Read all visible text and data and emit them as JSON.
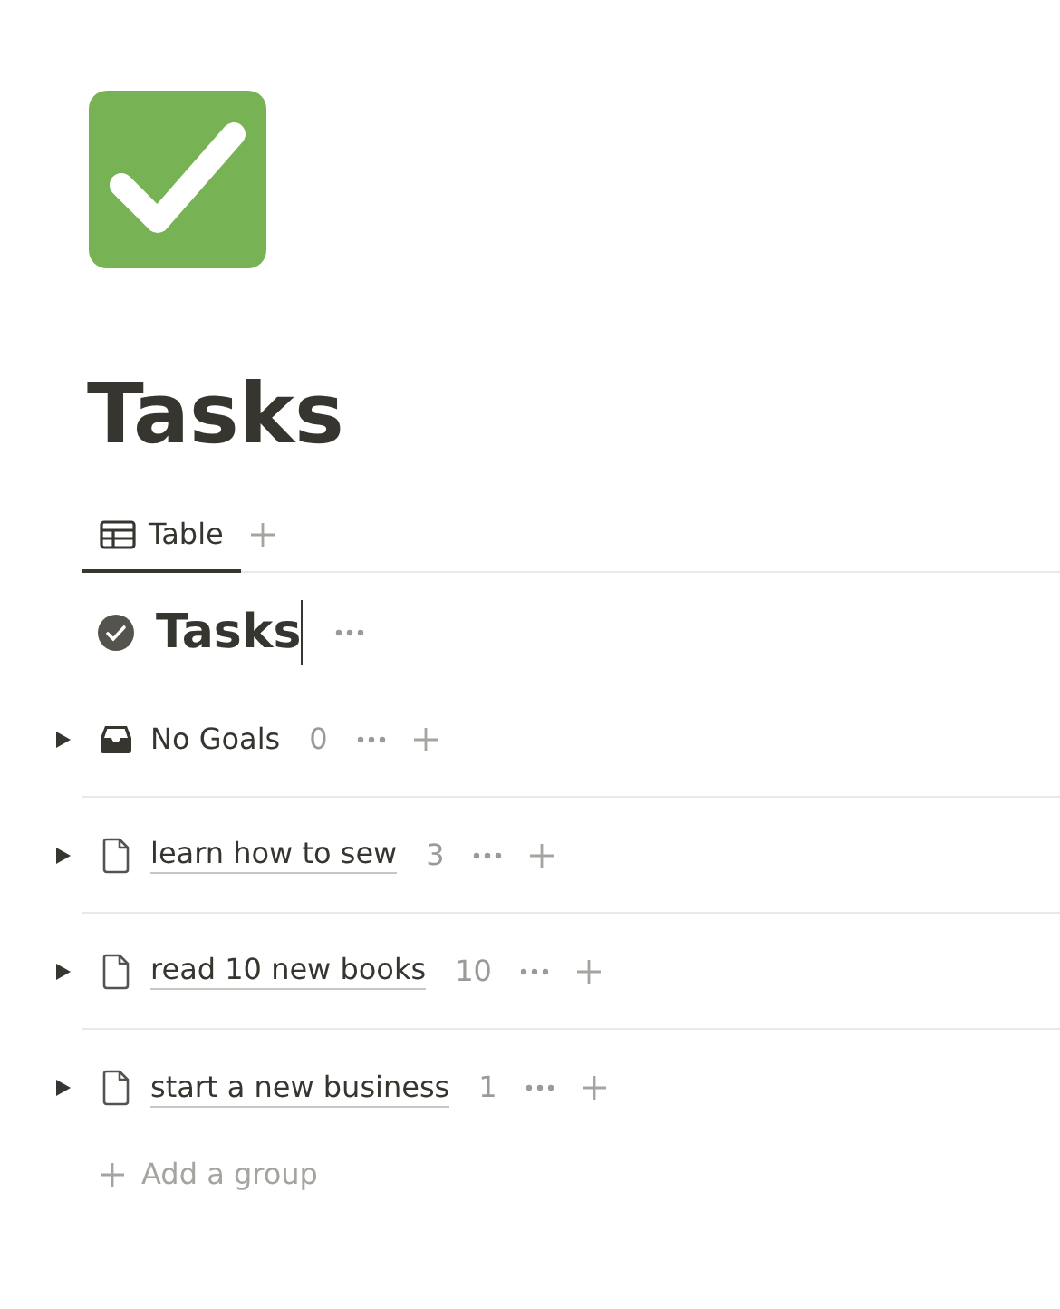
{
  "page": {
    "title": "Tasks"
  },
  "views": [
    {
      "label": "Table",
      "selected": true
    }
  ],
  "database": {
    "title": "Tasks"
  },
  "groups": [
    {
      "kind": "none",
      "name": "No Goals",
      "count": "0",
      "expanded": false
    },
    {
      "kind": "page",
      "name": "learn how to sew",
      "count": "3",
      "expanded": false
    },
    {
      "kind": "page",
      "name": "read 10 new books",
      "count": "10",
      "expanded": false
    },
    {
      "kind": "page",
      "name": "start a new business",
      "count": "1",
      "expanded": false
    }
  ],
  "add_group": "Add a group"
}
